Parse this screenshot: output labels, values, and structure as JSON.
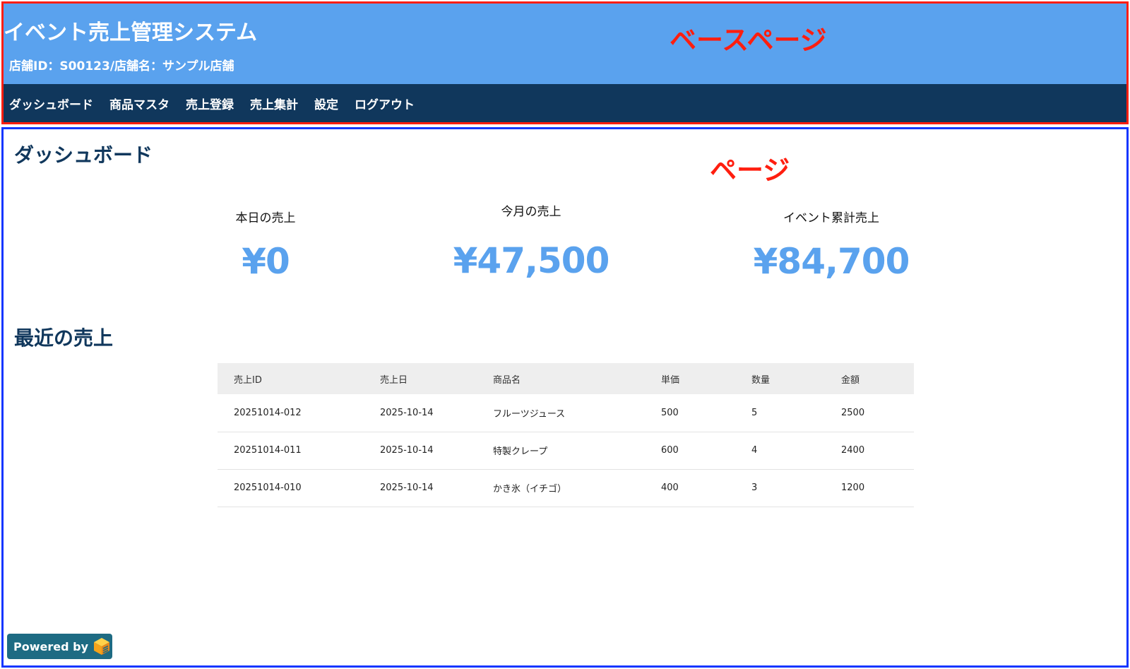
{
  "header": {
    "app_title": "イベント売上管理システム",
    "store_info": "店舗ID：S00123/店舗名：サンプル店舗",
    "annotation": "ベースページ"
  },
  "nav": {
    "items": [
      {
        "label": "ダッシュボード"
      },
      {
        "label": "商品マスタ"
      },
      {
        "label": "売上登録"
      },
      {
        "label": "売上集計"
      },
      {
        "label": "設定"
      },
      {
        "label": "ログアウト"
      }
    ]
  },
  "page": {
    "title": "ダッシュボード",
    "annotation": "ページ"
  },
  "stats": {
    "today": {
      "label": "本日の売上",
      "value": "¥0"
    },
    "month": {
      "label": "今月の売上",
      "value": "¥47,500"
    },
    "event": {
      "label": "イベント累計売上",
      "value": "¥84,700"
    }
  },
  "recent_sales": {
    "title": "最近の売上",
    "columns": [
      "売上ID",
      "売上日",
      "商品名",
      "単価",
      "数量",
      "金額"
    ],
    "rows": [
      [
        "20251014-012",
        "2025-10-14",
        "フルーツジュース",
        "500",
        "5",
        "2500"
      ],
      [
        "20251014-011",
        "2025-10-14",
        "特製クレープ",
        "600",
        "4",
        "2400"
      ],
      [
        "20251014-010",
        "2025-10-14",
        "かき氷（イチゴ）",
        "400",
        "3",
        "1200"
      ]
    ]
  },
  "footer": {
    "powered_label": "Powered by",
    "powered_icon": "cube-logo-icon"
  },
  "colors": {
    "header_bg": "#5aa2ee",
    "nav_bg": "#10375c",
    "accent": "#5aa2ee",
    "annotation_red": "#ff1e0f",
    "annotation_blue": "#1436ff"
  }
}
